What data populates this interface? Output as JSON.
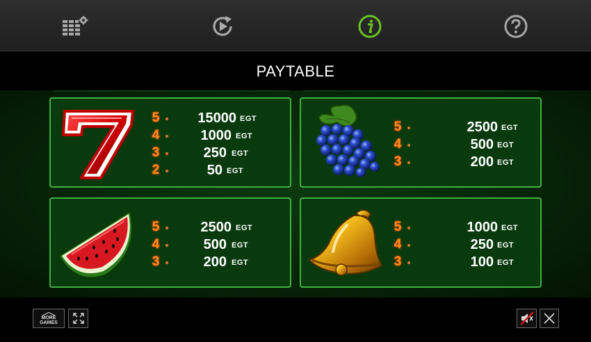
{
  "topbar": {
    "buttons": [
      {
        "name": "settings",
        "icon": "bet-settings-icon"
      },
      {
        "name": "autoplay",
        "icon": "autoplay-icon"
      },
      {
        "name": "info",
        "icon": "info-icon",
        "active": true,
        "active_color": "#6ac322"
      },
      {
        "name": "help",
        "icon": "help-icon"
      }
    ]
  },
  "title": "PAYTABLE",
  "colors": {
    "card_border": "#3fb241",
    "card_bg": "#093a0d",
    "count_color": "#ff8a1e"
  },
  "paytable": [
    {
      "symbol": "seven",
      "rows": [
        {
          "count": "5",
          "value": "15000",
          "currency": "EGT"
        },
        {
          "count": "4",
          "value": "1000",
          "currency": "EGT"
        },
        {
          "count": "3",
          "value": "250",
          "currency": "EGT"
        },
        {
          "count": "2",
          "value": "50",
          "currency": "EGT"
        }
      ]
    },
    {
      "symbol": "grapes",
      "rows": [
        {
          "count": "5",
          "value": "2500",
          "currency": "EGT"
        },
        {
          "count": "4",
          "value": "500",
          "currency": "EGT"
        },
        {
          "count": "3",
          "value": "200",
          "currency": "EGT"
        }
      ]
    },
    {
      "symbol": "watermelon",
      "rows": [
        {
          "count": "5",
          "value": "2500",
          "currency": "EGT"
        },
        {
          "count": "4",
          "value": "500",
          "currency": "EGT"
        },
        {
          "count": "3",
          "value": "200",
          "currency": "EGT"
        }
      ]
    },
    {
      "symbol": "bell",
      "rows": [
        {
          "count": "5",
          "value": "1000",
          "currency": "EGT"
        },
        {
          "count": "4",
          "value": "250",
          "currency": "EGT"
        },
        {
          "count": "3",
          "value": "100",
          "currency": "EGT"
        }
      ]
    }
  ],
  "bottombar": {
    "more_games_line1": "MORE",
    "more_games_line2": "GAMES",
    "fullscreen_icon": "fullscreen-icon",
    "sound_icon": "sound-muted-icon",
    "close_icon": "close-icon"
  }
}
